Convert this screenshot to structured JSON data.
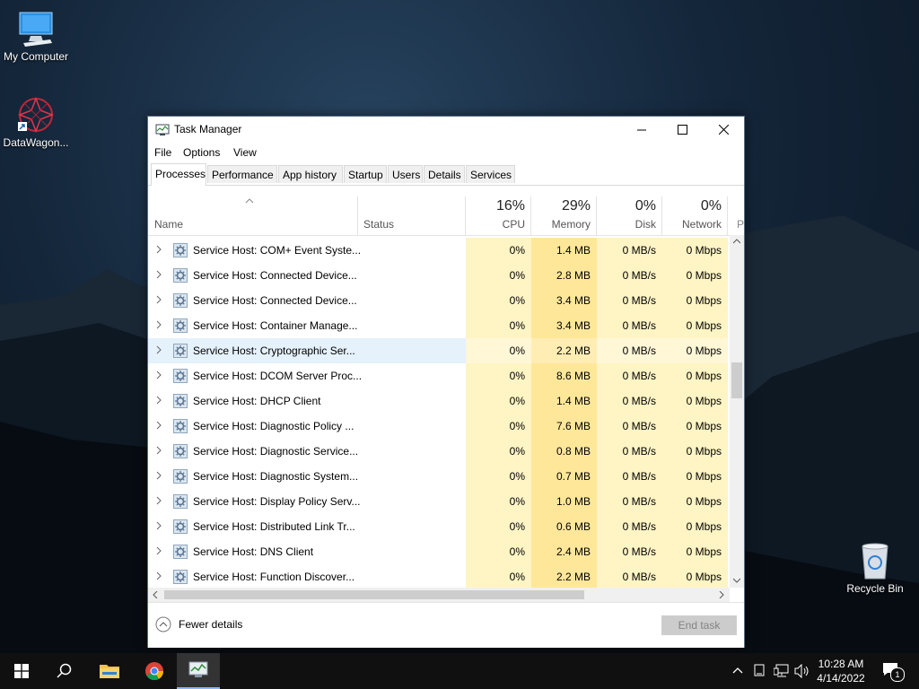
{
  "desktop": {
    "icons": [
      {
        "label": "My Computer"
      },
      {
        "label": "DataWagon..."
      },
      {
        "label": "Recycle Bin"
      }
    ]
  },
  "task_manager": {
    "title": "Task Manager",
    "menu": [
      "File",
      "Options",
      "View"
    ],
    "tabs": [
      "Processes",
      "Performance",
      "App history",
      "Startup",
      "Users",
      "Details",
      "Services"
    ],
    "active_tab": "Processes",
    "columns": {
      "name": "Name",
      "status": "Status",
      "cpu": {
        "percent": "16%",
        "label": "CPU"
      },
      "memory": {
        "percent": "29%",
        "label": "Memory"
      },
      "disk": {
        "percent": "0%",
        "label": "Disk"
      },
      "network": {
        "percent": "0%",
        "label": "Network"
      },
      "next": "P"
    },
    "rows": [
      {
        "name": "Service Host: COM+ Event Syste...",
        "cpu": "0%",
        "memory": "1.4 MB",
        "disk": "0 MB/s",
        "network": "0 Mbps"
      },
      {
        "name": "Service Host: Connected Device...",
        "cpu": "0%",
        "memory": "2.8 MB",
        "disk": "0 MB/s",
        "network": "0 Mbps"
      },
      {
        "name": "Service Host: Connected Device...",
        "cpu": "0%",
        "memory": "3.4 MB",
        "disk": "0 MB/s",
        "network": "0 Mbps"
      },
      {
        "name": "Service Host: Container Manage...",
        "cpu": "0%",
        "memory": "3.4 MB",
        "disk": "0 MB/s",
        "network": "0 Mbps"
      },
      {
        "name": "Service Host: Cryptographic Ser...",
        "cpu": "0%",
        "memory": "2.2 MB",
        "disk": "0 MB/s",
        "network": "0 Mbps",
        "selected": true
      },
      {
        "name": "Service Host: DCOM Server Proc...",
        "cpu": "0%",
        "memory": "8.6 MB",
        "disk": "0 MB/s",
        "network": "0 Mbps"
      },
      {
        "name": "Service Host: DHCP Client",
        "cpu": "0%",
        "memory": "1.4 MB",
        "disk": "0 MB/s",
        "network": "0 Mbps"
      },
      {
        "name": "Service Host: Diagnostic Policy ...",
        "cpu": "0%",
        "memory": "7.6 MB",
        "disk": "0 MB/s",
        "network": "0 Mbps"
      },
      {
        "name": "Service Host: Diagnostic Service...",
        "cpu": "0%",
        "memory": "0.8 MB",
        "disk": "0 MB/s",
        "network": "0 Mbps"
      },
      {
        "name": "Service Host: Diagnostic System...",
        "cpu": "0%",
        "memory": "0.7 MB",
        "disk": "0 MB/s",
        "network": "0 Mbps"
      },
      {
        "name": "Service Host: Display Policy Serv...",
        "cpu": "0%",
        "memory": "1.0 MB",
        "disk": "0 MB/s",
        "network": "0 Mbps"
      },
      {
        "name": "Service Host: Distributed Link Tr...",
        "cpu": "0%",
        "memory": "0.6 MB",
        "disk": "0 MB/s",
        "network": "0 Mbps"
      },
      {
        "name": "Service Host: DNS Client",
        "cpu": "0%",
        "memory": "2.4 MB",
        "disk": "0 MB/s",
        "network": "0 Mbps"
      },
      {
        "name": "Service Host: Function Discover...",
        "cpu": "0%",
        "memory": "2.2 MB",
        "disk": "0 MB/s",
        "network": "0 Mbps"
      }
    ],
    "footer": {
      "fewer_details": "Fewer details",
      "end_task": "End task"
    }
  },
  "taskbar": {
    "clock_time": "10:28 AM",
    "clock_date": "4/14/2022",
    "notification_count": "1"
  }
}
